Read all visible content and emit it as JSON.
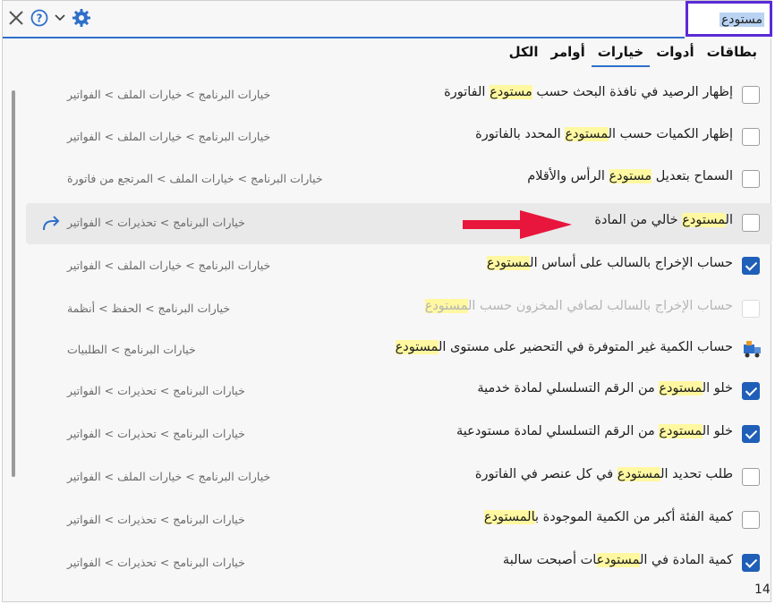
{
  "search": {
    "value": "مستودع"
  },
  "tabs": [
    {
      "label": "الكل",
      "active": false
    },
    {
      "label": "أوامر",
      "active": false
    },
    {
      "label": "خيارات",
      "active": true
    },
    {
      "label": "أدوات",
      "active": false
    },
    {
      "label": "بطاقات",
      "active": false
    }
  ],
  "rows": [
    {
      "pre": "إظهار الرصيد في نافذة البحث حسب ",
      "hl": "مستودع",
      "post": " الفاتورة",
      "path": "خيارات البرنامج > خيارات الملف > الفواتير",
      "checked": false,
      "disabled": false
    },
    {
      "pre": "إظهار الكميات حسب ال",
      "hl": "مستودع",
      "post": " المحدد بالفاتورة",
      "path": "خيارات البرنامج > خيارات الملف > الفواتير",
      "checked": false,
      "disabled": false
    },
    {
      "pre": "السماح بتعديل ",
      "hl": "مستودع",
      "post": " الرأس والأقلام",
      "path": "خيارات البرنامج > خيارات الملف > المرتجع من فاتورة",
      "checked": false,
      "disabled": false
    },
    {
      "pre": "ال",
      "hl": "مستودع",
      "post": " خالي من المادة",
      "path": "خيارات البرنامج > تحذيرات > الفواتير",
      "checked": false,
      "disabled": false
    },
    {
      "pre": "حساب الإخراج بالسالب على أساس ال",
      "hl": "مستودع",
      "post": "",
      "path": "خيارات البرنامج > خيارات الملف > الفواتير",
      "checked": true,
      "disabled": false
    },
    {
      "pre": "حساب الإخراج بالسالب لصافي المخزون حسب ال",
      "hl": "مستودع",
      "post": "",
      "path": "خيارات البرنامج > الحفظ > أنظمة",
      "checked": false,
      "disabled": true
    },
    {
      "pre": "حساب الكمية غير المتوفرة في التحضير على مستوى ال",
      "hl": "مستودع",
      "post": "",
      "path": "خيارات البرنامج > الطلبيات",
      "checked": false,
      "disabled": false
    },
    {
      "pre": "خلو ال",
      "hl": "مستودع",
      "post": " من الرقم التسلسلي لمادة خدمية",
      "path": "خيارات البرنامج > تحذيرات > الفواتير",
      "checked": true,
      "disabled": false
    },
    {
      "pre": "خلو ال",
      "hl": "مستودع",
      "post": " من الرقم التسلسلي لمادة مستودعية",
      "path": "خيارات البرنامج > تحذيرات > الفواتير",
      "checked": true,
      "disabled": false
    },
    {
      "pre": "طلب تحديد ال",
      "hl": "مستودع",
      "post": " في كل عنصر في الفاتورة",
      "path": "خيارات البرنامج > خيارات الملف > الفواتير",
      "checked": false,
      "disabled": false
    },
    {
      "pre": "كمية الفئة أكبر من الكمية الموجودة ب",
      "hl": "المستودع",
      "post": "",
      "path": "خيارات البرنامج > تحذيرات > الفواتير",
      "checked": false,
      "disabled": false
    },
    {
      "pre": "كمية المادة في ال",
      "hl": "مستودع",
      "post": "ات أصبحت سالبة",
      "path": "خيارات البرنامج > تحذيرات > الفواتير",
      "checked": true,
      "disabled": false
    }
  ],
  "result_count": "14",
  "icons": {
    "close": "close-icon",
    "help": "help-icon",
    "dropdown": "chevron-down-icon",
    "settings": "gear-icon",
    "redo": "redo-arrow-icon",
    "truck": "truck-icon"
  },
  "colors": {
    "accent": "#1f5fb8",
    "highlight": "#fff8a0",
    "focus_border": "#5b2bd6",
    "annotation_arrow": "#e8163c"
  }
}
